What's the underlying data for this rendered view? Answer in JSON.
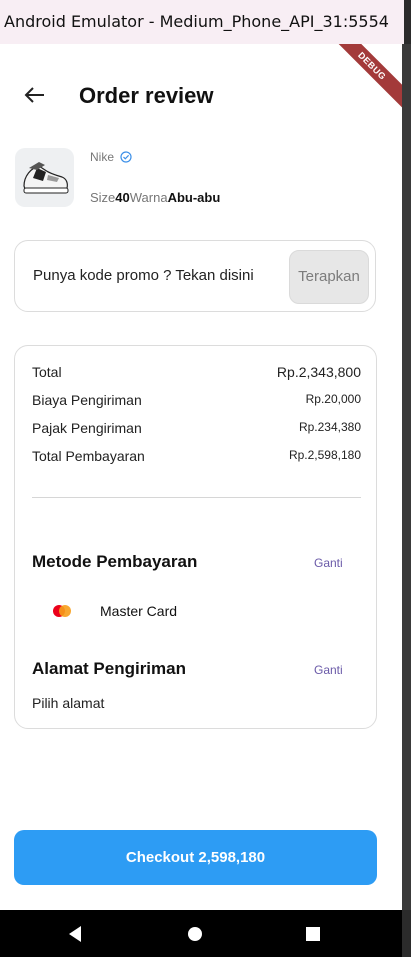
{
  "window": {
    "title": "Android Emulator - Medium_Phone_API_31:5554"
  },
  "debug_banner": "DEBUG",
  "header": {
    "title": "Order review"
  },
  "product": {
    "brand": "Nike",
    "size_label": "Size",
    "size_value": "40",
    "color_label": "Warna",
    "color_value": "Abu-abu"
  },
  "promo": {
    "text": "Punya kode promo ? Tekan disini",
    "apply_label": "Terapkan"
  },
  "summary": {
    "rows": [
      {
        "label": "Total",
        "value": "Rp.2,343,800"
      },
      {
        "label": "Biaya Pengiriman",
        "value": "Rp.20,000"
      },
      {
        "label": "Pajak Pengiriman",
        "value": "Rp.234,380"
      },
      {
        "label": "Total Pembayaran",
        "value": "Rp.2,598,180"
      }
    ]
  },
  "payment": {
    "title": "Metode Pembayaran",
    "change_label": "Ganti",
    "method_icon": "mastercard-icon",
    "method_label": "Master Card"
  },
  "shipping": {
    "title": "Alamat Pengiriman",
    "change_label": "Ganti",
    "address": "Pilih alamat"
  },
  "checkout": {
    "label": "Checkout 2,598,180"
  },
  "colors": {
    "primary": "#2d9cf4",
    "link": "#6a5aa8",
    "debug_ribbon": "#a33a3a",
    "verified": "#3b8fe8"
  }
}
